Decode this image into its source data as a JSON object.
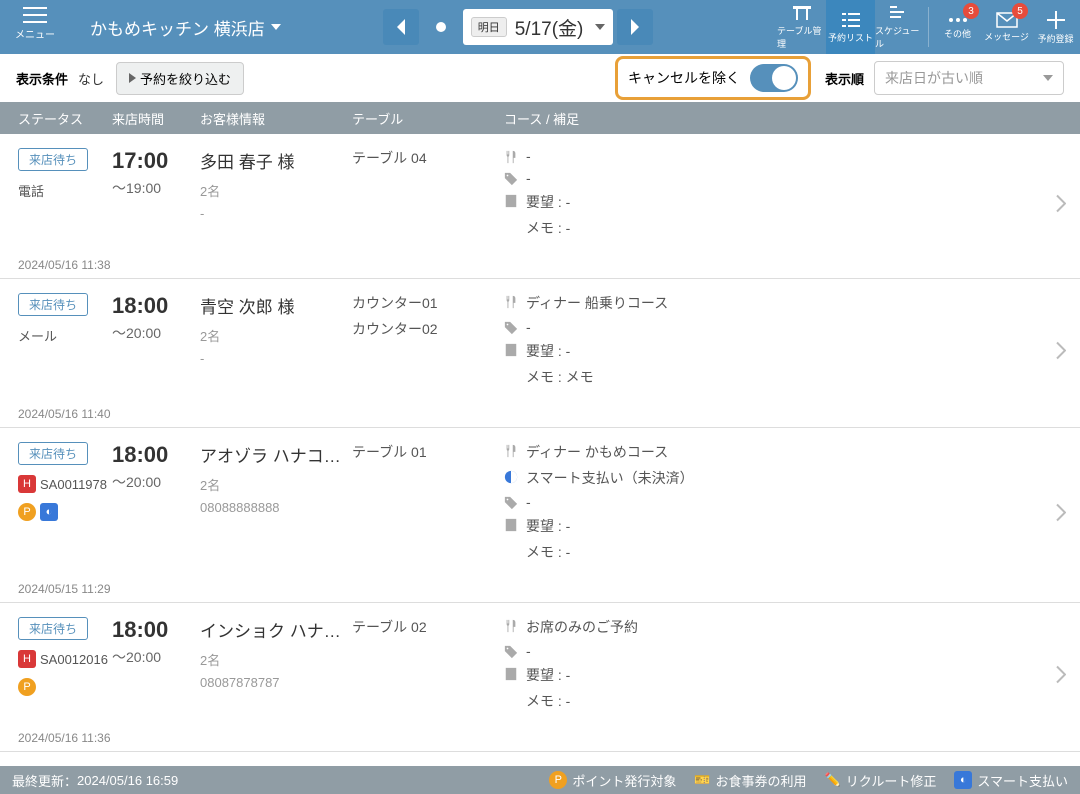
{
  "header": {
    "menu_label": "メニュー",
    "store_name": "かもめキッチン 横浜店",
    "date_badge": "明日",
    "date_text": "5/17(金)",
    "icons": {
      "table_mgmt": "テーブル管理",
      "reserve_list": "予約リスト",
      "schedule": "スケジュール",
      "other": "その他",
      "other_badge": "3",
      "message": "メッセージ",
      "message_badge": "5",
      "register": "予約登録"
    }
  },
  "filter": {
    "label": "表示条件",
    "none": "なし",
    "button": "予約を絞り込む",
    "cancel_label": "キャンセルを除く",
    "sort_label": "表示順",
    "sort_value": "来店日が古い順"
  },
  "columns": {
    "status": "ステータス",
    "time": "来店時間",
    "customer": "お客様情報",
    "table": "テーブル",
    "course": "コース / 補足"
  },
  "reservations": [
    {
      "status": "来店待ち",
      "source": "電話",
      "source_icons": [],
      "source_code": "",
      "timestamp": "2024/05/16 11:38",
      "time_main": "17:00",
      "time_end": "～19:00",
      "customer": "多田 春子 様",
      "count": "2名",
      "phone": "-",
      "tables": [
        "テーブル 04"
      ],
      "course": "-",
      "smartpay": "",
      "tag": "-",
      "request": "要望 : -",
      "memo": "メモ : -"
    },
    {
      "status": "来店待ち",
      "source": "メール",
      "source_icons": [],
      "source_code": "",
      "timestamp": "2024/05/16 11:40",
      "time_main": "18:00",
      "time_end": "～20:00",
      "customer": "青空 次郎 様",
      "count": "2名",
      "phone": "-",
      "tables": [
        "カウンター01",
        "カウンター02"
      ],
      "course": "ディナー 船乗りコース",
      "smartpay": "",
      "tag": "-",
      "request": "要望 : -",
      "memo": "メモ : メモ"
    },
    {
      "status": "来店待ち",
      "source": "",
      "source_icons": [
        "H",
        "P",
        "blue"
      ],
      "source_code": "SA0011978",
      "timestamp": "2024/05/15 11:29",
      "time_main": "18:00",
      "time_end": "～20:00",
      "customer": "アオゾラ ハナコ…",
      "count": "2名",
      "phone": "08088888888",
      "tables": [
        "テーブル 01"
      ],
      "course": "ディナー かもめコース",
      "smartpay": "スマート支払い（未決済）",
      "tag": "-",
      "request": "要望 : -",
      "memo": "メモ : -"
    },
    {
      "status": "来店待ち",
      "source": "",
      "source_icons": [
        "H",
        "P"
      ],
      "source_code": "SA0012016",
      "timestamp": "2024/05/16 11:36",
      "time_main": "18:00",
      "time_end": "～20:00",
      "customer": "インショク ハナ…",
      "count": "2名",
      "phone": "08087878787",
      "tables": [
        "テーブル 02"
      ],
      "course": "お席のみのご予約",
      "smartpay": "",
      "tag": "-",
      "request": "要望 : -",
      "memo": "メモ : -"
    }
  ],
  "footer": {
    "updated_label": "最終更新：",
    "updated_time": "2024/05/16 16:59",
    "legend": {
      "point": "ポイント発行対象",
      "ticket": "お食事券の利用",
      "recruit": "リクルート修正",
      "smartpay": "スマート支払い"
    }
  }
}
